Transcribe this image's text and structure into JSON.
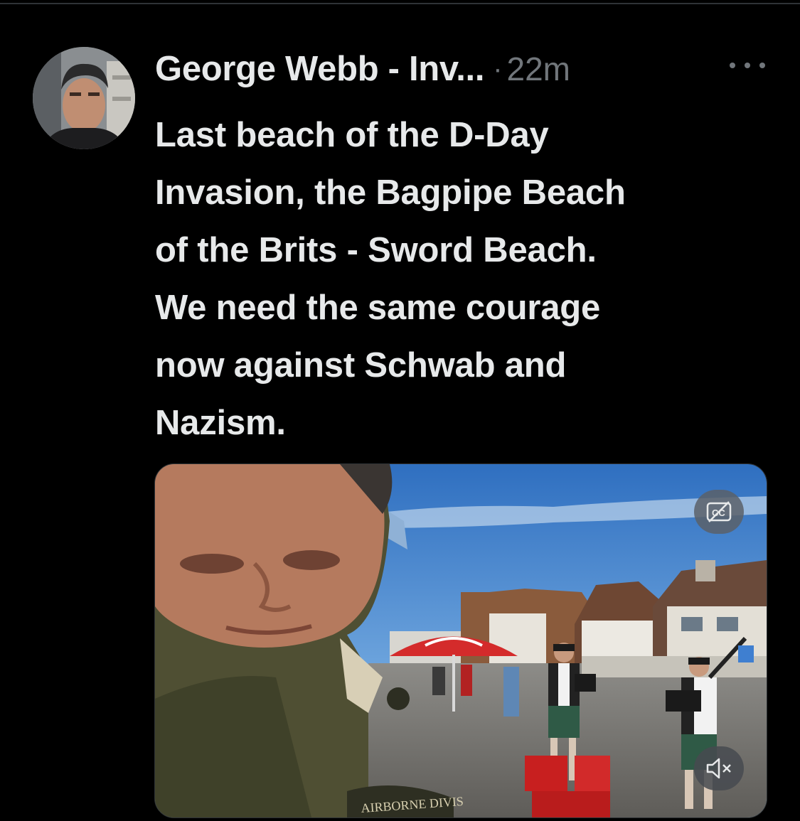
{
  "tweet": {
    "author_name": "George Webb - Inv...",
    "separator": "·",
    "timestamp": "22m",
    "text": "Last beach of the D-Day\nInvasion, the Bagpipe Beach\nof the Brits - Sword Beach.\nWe need the same courage\nnow against Schwab and\nNazism."
  },
  "media": {
    "type": "video",
    "closed_captions": "off",
    "sound": "muted",
    "shirt_patch_text": "AIRBORNE DIVIS"
  },
  "icons": {
    "more": "more-horizontal-icon",
    "captions": "closed-captions-off-icon",
    "mute": "speaker-muted-icon"
  },
  "colors": {
    "background": "#000000",
    "text_primary": "#e7e9ea",
    "text_secondary": "#71767b",
    "divider": "#2f3336"
  }
}
